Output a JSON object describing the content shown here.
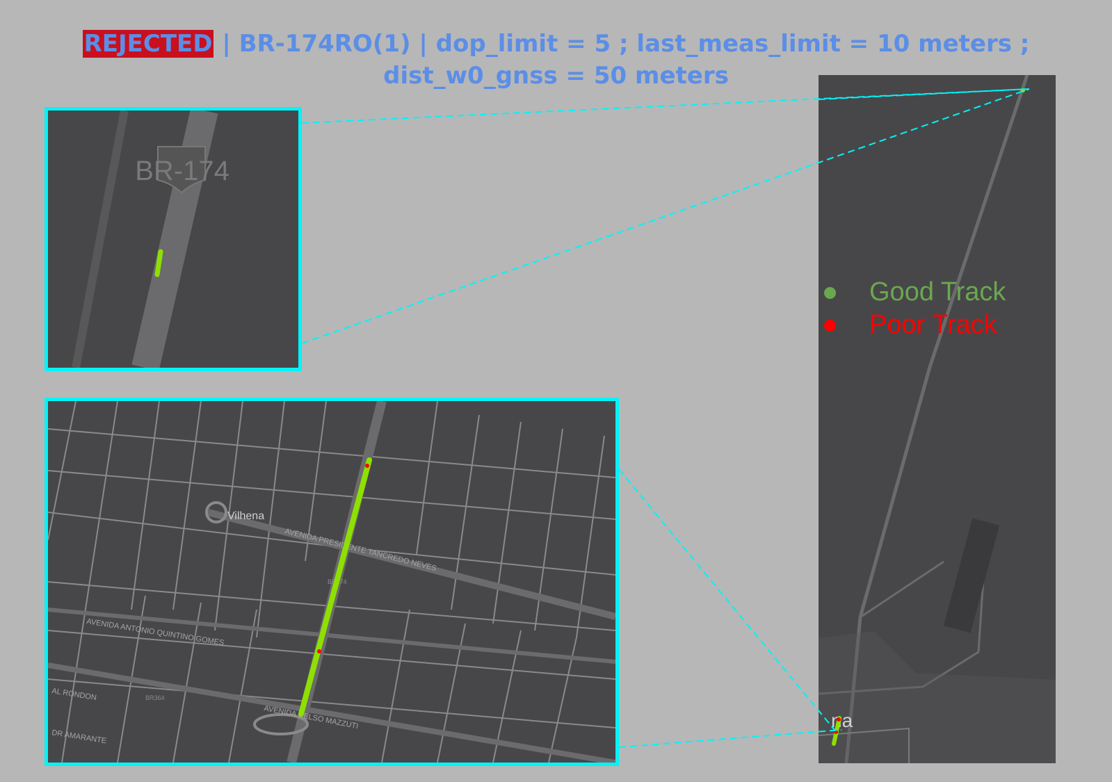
{
  "title": {
    "status": "REJECTED",
    "line1": " | BR-174RO(1) | dop_limit = 5 ; last_meas_limit = 10 meters ;",
    "line2": "dist_w0_gnss = 50 meters"
  },
  "colors": {
    "status_bg": "#c8101e",
    "title_text": "#5b8ee6",
    "inset_border": "#00f4f8",
    "map_bg": "#474749",
    "road": "#6b6b6d",
    "good_track": "#8ee000",
    "poor_track": "#ff0000",
    "background": "#b7b7b7"
  },
  "inset_top": {
    "road_shield": "BR-174"
  },
  "inset_bottom": {
    "labels": {
      "city": "Vilhena",
      "avenida_presidente": "AVENIDA PRESIDENTE TANCREDO NEVES",
      "avenida_antonio": "AVENIDA ANTONIO QUINTINO GOMES",
      "avenida_celso": "AVENIDA CELSO MAZZUTI",
      "al_rondon": "AL RONDON",
      "dr_amarante": "DR AMARANTE",
      "br364": "BR364",
      "br174": "BR174"
    }
  },
  "overview": {
    "label": "na"
  },
  "legend": {
    "good": "Good Track",
    "poor": "Poor Track"
  }
}
